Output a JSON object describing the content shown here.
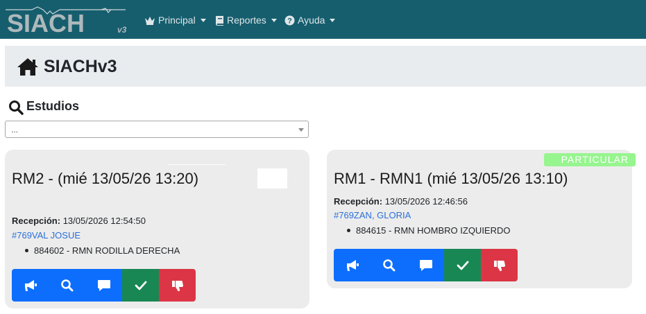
{
  "navbar": {
    "logo_text": "SIACH",
    "logo_version": "v3",
    "menus": [
      {
        "label": "Principal",
        "icon": "crown-icon"
      },
      {
        "label": "Reportes",
        "icon": "book-icon"
      },
      {
        "label": "Ayuda",
        "icon": "question-circle-icon"
      }
    ]
  },
  "header": {
    "title": "SIACHv3",
    "icon": "home-icon"
  },
  "studies": {
    "title": "Estudios",
    "icon": "search-icon",
    "select_value": "..."
  },
  "cards": [
    {
      "title": "RM2 - (mié 13/05/26  13:20)",
      "reception_label": "Recepción:",
      "reception_value": "13/05/2026 12:54:50",
      "patient": "#769VAL JOSUE",
      "study": "884602 - RMN RODILLA DERECHA",
      "badge": ""
    },
    {
      "title": "RM1 - RMN1 (mié 13/05/26 13:10)",
      "reception_label": "Recepción:",
      "reception_value": "13/05/2026 12:46:56",
      "patient": "#769ZAN, GLORIA",
      "study": "884615 - RMN HOMBRO IZQUIERDO",
      "badge": "PARTICULAR"
    }
  ],
  "buttons": [
    {
      "icon": "bullhorn-icon",
      "color": "#0d6efd"
    },
    {
      "icon": "search-icon",
      "color": "#0d6efd"
    },
    {
      "icon": "comment-icon",
      "color": "#0d6efd"
    },
    {
      "icon": "check-icon",
      "color": "#198754"
    },
    {
      "icon": "thumbs-down-icon",
      "color": "#dc3545"
    }
  ],
  "colors": {
    "navbar": "#165e6e",
    "link": "#2a6fd8",
    "badge": "#97f58f"
  }
}
